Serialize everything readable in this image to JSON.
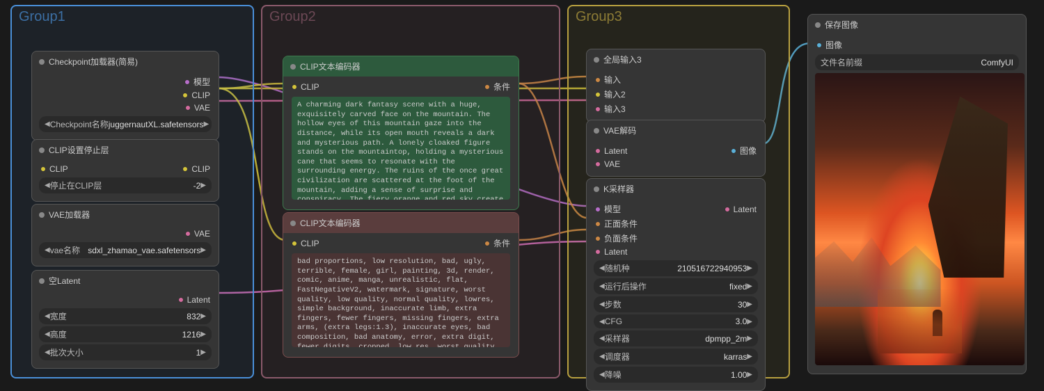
{
  "groups": {
    "g1": "Group1",
    "g2": "Group2",
    "g3": "Group3"
  },
  "nodes": {
    "checkpoint": {
      "title": "Checkpoint加载器(简易)",
      "outputs": [
        "模型",
        "CLIP",
        "VAE"
      ],
      "widget_label": "Checkpoint名称",
      "widget_value": "juggernautXL.safetensors"
    },
    "clip_stop": {
      "title": "CLIP设置停止层",
      "input": "CLIP",
      "output": "CLIP",
      "widget_label": "停止在CLIP层",
      "widget_value": "-2"
    },
    "vae_loader": {
      "title": "VAE加载器",
      "output": "VAE",
      "widget_label": "vae名称",
      "widget_value": "sdxl_zhamao_vae.safetensors"
    },
    "empty_latent": {
      "title": "空Latent",
      "output": "Latent",
      "widgets": [
        {
          "label": "宽度",
          "value": "832"
        },
        {
          "label": "高度",
          "value": "1216"
        },
        {
          "label": "批次大小",
          "value": "1"
        }
      ]
    },
    "clip_pos": {
      "title": "CLIP文本编码器",
      "input": "CLIP",
      "output": "条件",
      "text": "A charming dark fantasy scene with a huge, exquisitely carved face on the mountain. The hollow eyes of this mountain gaze into the distance, while its open mouth reveals a dark and mysterious path. A lonely cloaked figure stands on the mountaintop, holding a mysterious cane that seems to resonate with the surrounding energy. The ruins of the once great civilization are scattered at the foot of the mountain, adding a sense of surprise and conspiracy. The fiery orange and red sky create a stunning backdrop, implying either a stunning sunset or a catastrophic event. This conceptual artwork cleverly blends elements of cinematic aesthetics and dark fantasy, immersing the audience in a world of mystery and wonder., Conceptual art, dark fantasy, movies"
    },
    "clip_neg": {
      "title": "CLIP文本编码器",
      "input": "CLIP",
      "output": "条件",
      "text": "bad proportions, low resolution, bad, ugly, terrible, female, girl, painting, 3d, render, comic, anime, manga, unrealistic, flat, FastNegativeV2, watermark, signature, worst quality, low quality, normal quality, lowres, simple background, inaccurate limb, extra fingers, fewer fingers, missing fingers, extra arms, (extra legs:1.3), inaccurate eyes, bad composition, bad anatomy, error, extra digit, fewer digits, cropped, low res, worst quality, low quality, normal quality, jpeg artifacts, extra digit, fewer digits, trademark, watermark, artist's name, username, signature, text, words, human, american flag, muscular"
    },
    "global_in": {
      "title": "全局输入3",
      "inputs": [
        "输入",
        "输入2",
        "输入3"
      ]
    },
    "vae_decode": {
      "title": "VAE解码",
      "inputs": [
        "Latent",
        "VAE"
      ],
      "output": "图像"
    },
    "ksampler": {
      "title": "K采样器",
      "inputs": [
        "模型",
        "正面条件",
        "负面条件",
        "Latent"
      ],
      "output": "Latent",
      "widgets": [
        {
          "label": "随机种",
          "value": "210516722940953"
        },
        {
          "label": "运行后操作",
          "value": "fixed"
        },
        {
          "label": "步数",
          "value": "30"
        },
        {
          "label": "CFG",
          "value": "3.0"
        },
        {
          "label": "采样器",
          "value": "dpmpp_2m"
        },
        {
          "label": "调度器",
          "value": "karras"
        },
        {
          "label": "降噪",
          "value": "1.00"
        }
      ]
    },
    "save_image": {
      "title": "保存图像",
      "input": "图像",
      "widget_label": "文件名前缀",
      "widget_value": "ComfyUI"
    }
  }
}
